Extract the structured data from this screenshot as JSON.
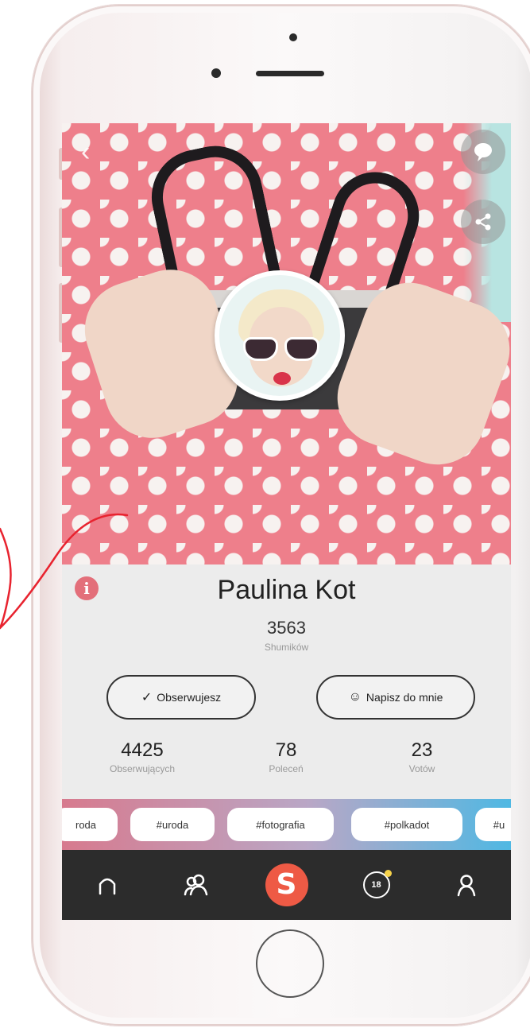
{
  "profile": {
    "name": "Paulina Kot",
    "score": "3563",
    "score_label": "Shumików"
  },
  "actions": {
    "follow_label": "Obserwujesz",
    "message_label": "Napisz do mnie"
  },
  "stats": [
    {
      "value": "4425",
      "label": "Obserwujących"
    },
    {
      "value": "78",
      "label": "Poleceń"
    },
    {
      "value": "23",
      "label": "Votów"
    }
  ],
  "tags": [
    "roda",
    "#uroda",
    "#fotografia",
    "#polkadot",
    "#u"
  ],
  "nav": {
    "logo_letter": "S",
    "age_badge": "18"
  },
  "icons": [
    "back-icon",
    "chat-bubble-icon",
    "share-icon",
    "info-icon",
    "check-icon",
    "message-icon",
    "home-icon",
    "users-icon",
    "age-18-icon",
    "profile-icon"
  ],
  "colors": {
    "brand": "#ee5a45",
    "hero_pink": "#ee7f8b",
    "nav_bg": "#2c2c2c",
    "info_icon": "#e36f7a",
    "annotation": "#e8232f"
  }
}
